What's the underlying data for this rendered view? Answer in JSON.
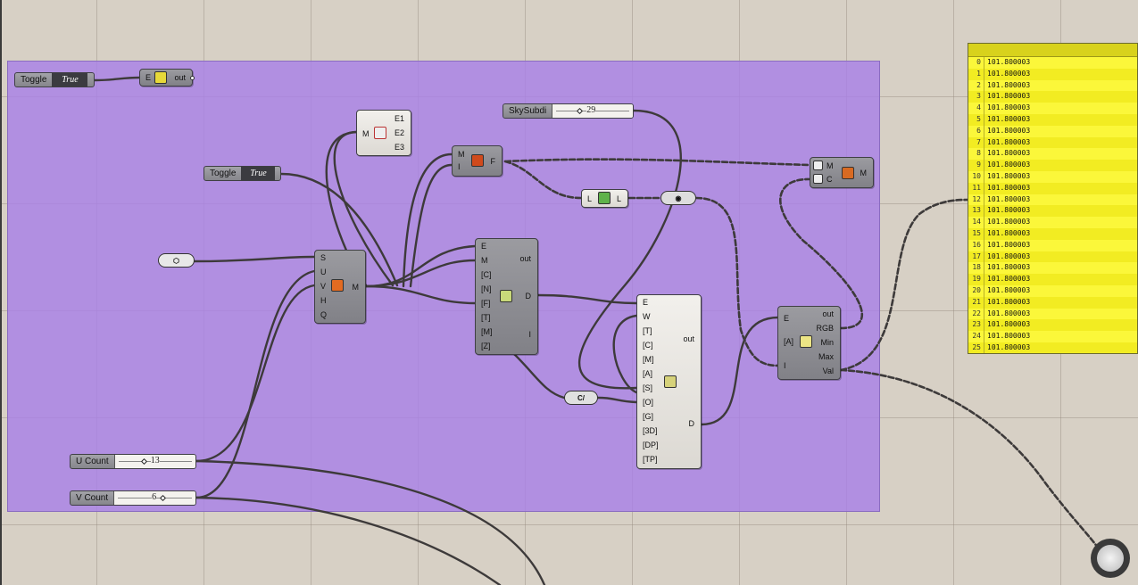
{
  "toggle1": {
    "label": "Toggle",
    "value": "True"
  },
  "toggle2": {
    "label": "Toggle",
    "value": "True"
  },
  "boolean_node": {
    "in": "E",
    "out": "out"
  },
  "explode_node": {
    "in": "M",
    "outs": [
      "E1",
      "E2",
      "E3"
    ]
  },
  "face_node": {
    "ins": [
      "M",
      "I"
    ],
    "out": "F"
  },
  "list_node": {
    "in": "L",
    "out": "L"
  },
  "move_node": {
    "ins": [
      "M",
      "C"
    ],
    "out": "M"
  },
  "mesh_surface_node": {
    "ins": [
      "S",
      "U",
      "V",
      "H",
      "Q"
    ],
    "out": "M"
  },
  "analysis_node": {
    "ins": [
      "E",
      "M",
      "[C]",
      "[N]",
      "[F]",
      "[T]",
      "[M]",
      "[Z]"
    ],
    "outs": [
      "out",
      "D",
      "I"
    ]
  },
  "radiation_node": {
    "ins": [
      "E",
      "W",
      "[T]",
      "[C]",
      "[M]",
      "[A]",
      "[S]",
      "[O]",
      "[G]",
      "[3D]",
      "[DP]",
      "[TP]"
    ],
    "outs": [
      "out",
      "D"
    ]
  },
  "color_node": {
    "ins": [
      "E",
      "[A]",
      "I"
    ],
    "outs": [
      "out",
      "RGB",
      "Min",
      "Max",
      "Val"
    ]
  },
  "sky_slider": {
    "label": "SkySubdi",
    "value": "29"
  },
  "u_slider": {
    "label": "U Count",
    "value": "13"
  },
  "v_slider": {
    "label": "V Count",
    "value": "6"
  },
  "panel": {
    "rows": [
      {
        "i": "0",
        "v": "101.800003"
      },
      {
        "i": "1",
        "v": "101.800003"
      },
      {
        "i": "2",
        "v": "101.800003"
      },
      {
        "i": "3",
        "v": "101.800003"
      },
      {
        "i": "4",
        "v": "101.800003"
      },
      {
        "i": "5",
        "v": "101.800003"
      },
      {
        "i": "6",
        "v": "101.800003"
      },
      {
        "i": "7",
        "v": "101.800003"
      },
      {
        "i": "8",
        "v": "101.800003"
      },
      {
        "i": "9",
        "v": "101.800003"
      },
      {
        "i": "10",
        "v": "101.800003"
      },
      {
        "i": "11",
        "v": "101.800003"
      },
      {
        "i": "12",
        "v": "101.800003"
      },
      {
        "i": "13",
        "v": "101.800003"
      },
      {
        "i": "14",
        "v": "101.800003"
      },
      {
        "i": "15",
        "v": "101.800003"
      },
      {
        "i": "16",
        "v": "101.800003"
      },
      {
        "i": "17",
        "v": "101.800003"
      },
      {
        "i": "18",
        "v": "101.800003"
      },
      {
        "i": "19",
        "v": "101.800003"
      },
      {
        "i": "20",
        "v": "101.800003"
      },
      {
        "i": "21",
        "v": "101.800003"
      },
      {
        "i": "22",
        "v": "101.800003"
      },
      {
        "i": "23",
        "v": "101.800003"
      },
      {
        "i": "24",
        "v": "101.800003"
      },
      {
        "i": "25",
        "v": "101.800003"
      }
    ]
  },
  "colors": {
    "group": "#a880e6",
    "panel": "#fbf73a",
    "wire": "#3d3a3a"
  }
}
